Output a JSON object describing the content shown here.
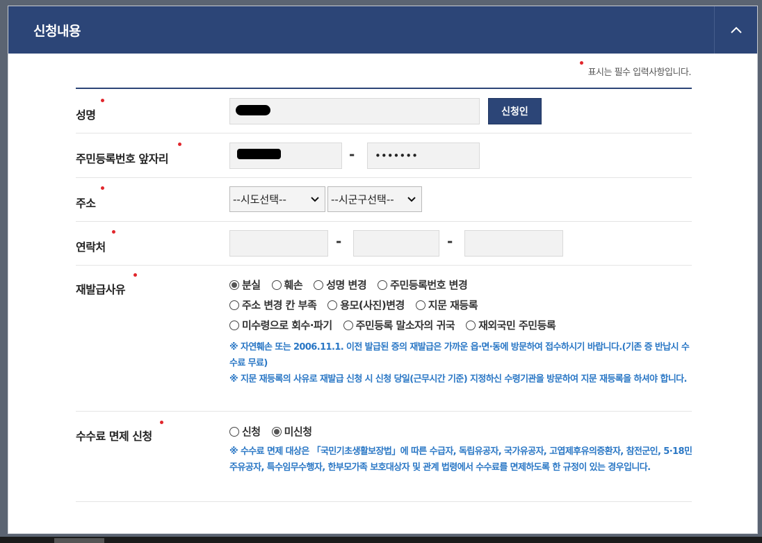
{
  "panel": {
    "title": "신청내용",
    "collapse_icon": "chevron-up-icon"
  },
  "required_note": "표시는 필수 입력사항입니다.",
  "fields": {
    "name": {
      "label": "성명",
      "button": "신청인"
    },
    "resident_front": {
      "label": "주민등록번호 앞자리",
      "back_value": "•••••••",
      "separator": "-"
    },
    "address": {
      "label": "주소",
      "sido": "--시도선택--",
      "sigungu": "--시군구선택--"
    },
    "contact": {
      "label": "연락처",
      "separator": "-"
    },
    "reason": {
      "label": "재발급사유",
      "options": [
        "분실",
        "훼손",
        "성명 변경",
        "주민등록번호 변경",
        "주소 변경 칸 부족",
        "용모(사진)변경",
        "지문 재등록",
        "미수령으로 회수·파기",
        "주민등록 말소자의 귀국",
        "재외국민 주민등록"
      ],
      "selected": "분실",
      "notes": [
        "※ 자연훼손 또는 2006.11.1. 이전 발급된 증의 재발급은 가까운 읍·면·동에 방문하여 접수하시기 바랍니다.(기존 증 반납시 수수료 무료)",
        "※ 지문 재등록의 사유로 재발급 신청 시 신청 당일(근무시간 기준) 지정하신 수령기관을 방문하여 지문 재등록을 하셔야 합니다."
      ]
    },
    "fee_waiver": {
      "label": "수수료 면제 신청",
      "options": [
        "신청",
        "미신청"
      ],
      "selected": "미신청",
      "note": "※ 수수료 면제 대상은 「국민기초생활보장법」에 따른 수급자, 독립유공자, 국가유공자, 고엽제후유의증환자, 참전군인, 5·18민주유공자, 특수임무수행자, 한부모가족 보호대상자 및 관계 법령에서 수수료를 면제하도록 한 규정이 있는 경우입니다."
    }
  },
  "colors": {
    "header": "#2c4577",
    "required_dot": "#e1262c",
    "note_text": "#2a77c5"
  }
}
